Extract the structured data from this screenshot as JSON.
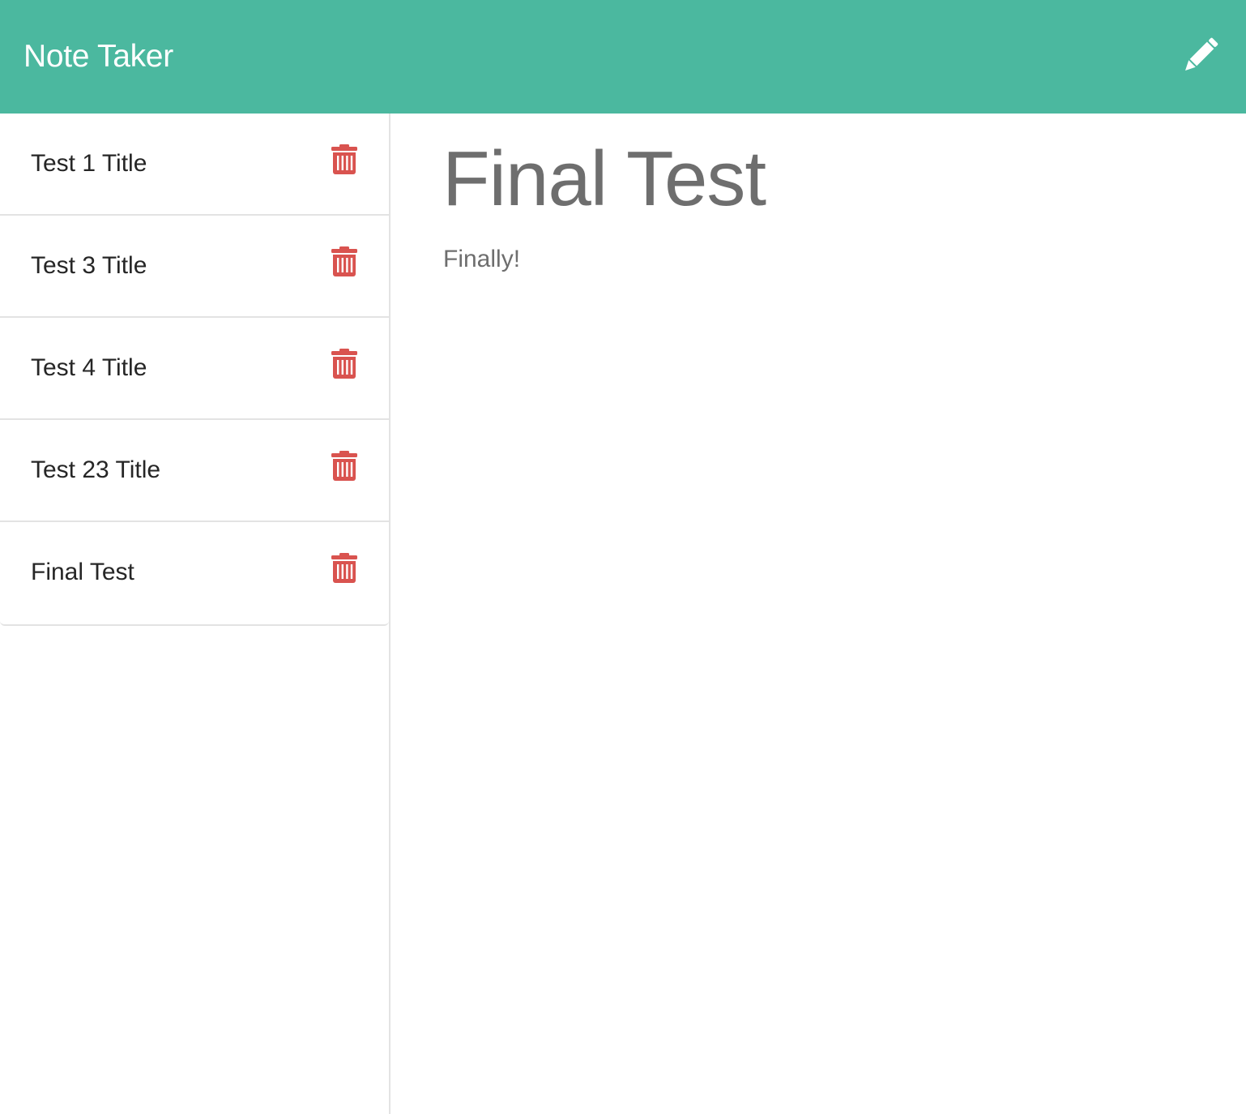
{
  "navbar": {
    "brand": "Note Taker",
    "new_note_icon": "pencil-icon"
  },
  "colors": {
    "navbar_bg": "#4bb89f",
    "delete_icon": "#d9534f",
    "view_text": "#6e6e6e"
  },
  "sidebar": {
    "notes": [
      {
        "title": "Test 1 Title",
        "delete_icon": "trash-icon"
      },
      {
        "title": "Test 3 Title",
        "delete_icon": "trash-icon"
      },
      {
        "title": "Test 4 Title",
        "delete_icon": "trash-icon"
      },
      {
        "title": "Test 23 Title",
        "delete_icon": "trash-icon"
      },
      {
        "title": "Final Test",
        "delete_icon": "trash-icon"
      }
    ]
  },
  "editor": {
    "title": "Final Test",
    "body": "Finally!"
  }
}
